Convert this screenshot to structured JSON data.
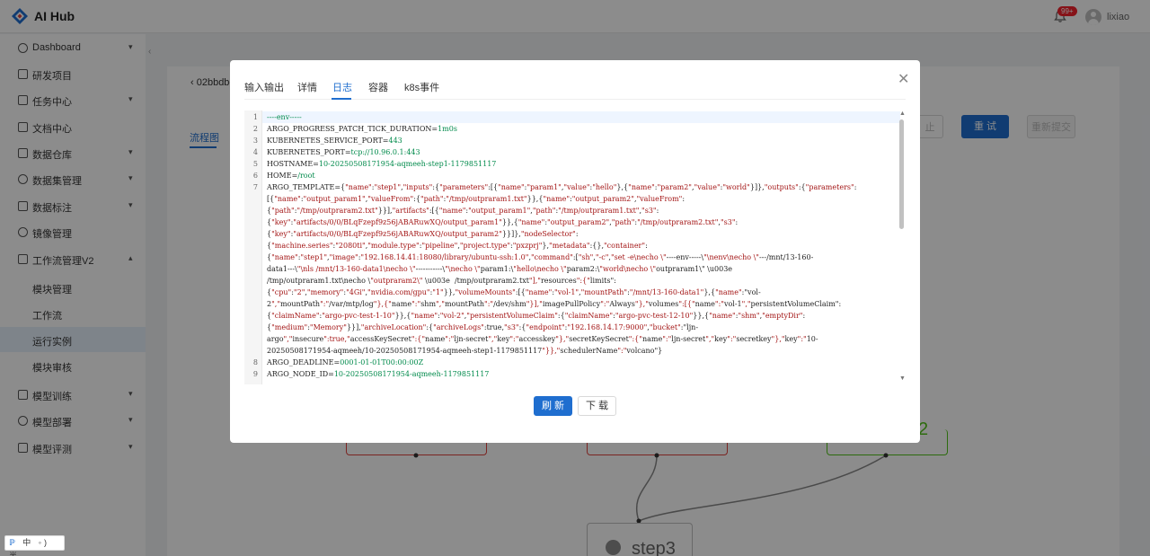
{
  "app": {
    "title": "AI Hub",
    "badge": "99+",
    "username": "lixiao"
  },
  "sidebar": {
    "items": [
      {
        "label": "Dashboard",
        "chevron": true
      },
      {
        "label": "研发项目",
        "chevron": false
      },
      {
        "label": "任务中心",
        "chevron": true
      },
      {
        "label": "文档中心",
        "chevron": false
      },
      {
        "label": "数据仓库",
        "chevron": true
      },
      {
        "label": "数据集管理",
        "chevron": true
      },
      {
        "label": "数据标注",
        "chevron": true
      },
      {
        "label": "镜像管理",
        "chevron": false
      },
      {
        "label": "工作流管理V2",
        "chevron": true
      }
    ],
    "subitems": [
      {
        "label": "模块管理"
      },
      {
        "label": "工作流"
      },
      {
        "label": "运行实例",
        "active": true
      },
      {
        "label": "模块审核"
      }
    ],
    "bottom_items": [
      {
        "label": "模型训练",
        "chevron": true
      },
      {
        "label": "模型部署",
        "chevron": true
      },
      {
        "label": "模型评测",
        "chevron": true
      }
    ]
  },
  "background": {
    "breadcrumb": "‹  02bbdbe",
    "tab": "流程图",
    "btn_faded": "止",
    "btn_retry": "重 试",
    "btn_resubmit": "重新提交",
    "node_green_text": "2",
    "node_step3": "step3"
  },
  "ime": {
    "text": "中 ◦) 半"
  },
  "modal": {
    "tabs": [
      "输入输出",
      "详情",
      "日志",
      "容器",
      "k8s事件"
    ],
    "active_tab": "日志",
    "close_icon": "close-icon",
    "refresh_label": "刷 新",
    "download_label": "下 载",
    "log_lines": [
      {
        "n": "1",
        "text": "----env-----"
      },
      {
        "n": "2",
        "text": "ARGO_PROGRESS_PATCH_TICK_DURATION=1m0s"
      },
      {
        "n": "3",
        "text": "KUBERNETES_SERVICE_PORT=443"
      },
      {
        "n": "4",
        "text": "KUBERNETES_PORT=tcp://10.96.0.1:443"
      },
      {
        "n": "5",
        "text": "HOSTNAME=10-20250508171954-aqmeeh-step1-1179851117"
      },
      {
        "n": "6",
        "text": "HOME=/root"
      },
      {
        "n": "7",
        "text": "ARGO_TEMPLATE={\"name\":\"step1\",\"inputs\":{\"parameters\":[{\"name\":\"param1\",\"value\":\"hello\"},{\"name\":\"param2\",\"value\":\"world\"}]},\"outputs\":{\"parameters\":"
      },
      {
        "n": "",
        "text": "[{\"name\":\"output_param1\",\"valueFrom\":{\"path\":\"/tmp/outpraram1.txt\"}},{\"name\":\"output_param2\",\"valueFrom\":"
      },
      {
        "n": "",
        "text": "{\"path\":\"/tmp/outpraram2.txt\"}}],\"artifacts\":[{\"name\":\"output_param1\",\"path\":\"/tmp/outpraram1.txt\",\"s3\":"
      },
      {
        "n": "",
        "text": "{\"key\":\"artifacts/0/0/BLqFzepf9z56jABARuwXQ/output_param1\"}},{\"name\":\"output_param2\",\"path\":\"/tmp/outpraram2.txt\",\"s3\":"
      },
      {
        "n": "",
        "text": "{\"key\":\"artifacts/0/0/BLqFzepf9z56jABARuwXQ/output_param2\"}}]},\"nodeSelector\":"
      },
      {
        "n": "",
        "text": "{\"machine.series\":\"2080ti\",\"module.type\":\"pipeline\",\"project.type\":\"pxzprj\"},\"metadata\":{},\"container\":"
      },
      {
        "n": "",
        "text": "{\"name\":\"step1\",\"image\":\"192.168.14.41:18080/library/ubuntu-ssh:1.0\",\"command\":[\"sh\",\"-c\",\"set -e\\necho \\\"----env-----\\\"\\nenv\\necho \\\"---/mnt/13-160-"
      },
      {
        "n": "",
        "text": "data1---\\\"\\nls /mnt/13-160-data1\\necho \\\"-----------\\\"\\necho \\\"param1:\\\"hello\\necho \\\"param2:\\\"world\\necho \\\"outpraram1\\\" \\u003e"
      },
      {
        "n": "",
        "text": "/tmp/outpraram1.txt\\necho \\\"outpraram2\\\" \\u003e  /tmp/outpraram2.txt\"],\"resources\":{\"limits\":"
      },
      {
        "n": "",
        "text": "{\"cpu\":\"2\",\"memory\":\"4Gi\",\"nvidia.com/gpu\":\"1\"}},\"volumeMounts\":[{\"name\":\"vol-1\",\"mountPath\":\"/mnt/13-160-data1\"},{\"name\":\"vol-"
      },
      {
        "n": "",
        "text": "2\",\"mountPath\":\"/var/mtp/log\"},{\"name\":\"shm\",\"mountPath\":\"/dev/shm\"}],\"imagePullPolicy\":\"Always\"},\"volumes\":[{\"name\":\"vol-1\",\"persistentVolumeClaim\":"
      },
      {
        "n": "",
        "text": "{\"claimName\":\"argo-pvc-test-1-10\"}},{\"name\":\"vol-2\",\"persistentVolumeClaim\":{\"claimName\":\"argo-pvc-test-12-10\"}},{\"name\":\"shm\",\"emptyDir\":"
      },
      {
        "n": "",
        "text": "{\"medium\":\"Memory\"}}],\"archiveLocation\":{\"archiveLogs\":true,\"s3\":{\"endpoint\":\"192.168.14.17:9000\",\"bucket\":\"ljn-"
      },
      {
        "n": "",
        "text": "argo\",\"insecure\":true,\"accessKeySecret\":{\"name\":\"ljn-secret\",\"key\":\"accesskey\"},\"secretKeySecret\":{\"name\":\"ljn-secret\",\"key\":\"secretkey\"},\"key\":\"10-"
      },
      {
        "n": "",
        "text": "20250508171954-aqmeeh/10-20250508171954-aqmeeh-step1-1179851117\"}},\"schedulerName\":\"volcano\"}"
      },
      {
        "n": "8",
        "text": "ARGO_DEADLINE=0001-01-01T00:00:00Z"
      },
      {
        "n": "9",
        "text": "ARGO_NODE_ID=10-20250508171954-aqmeeh-1179851117"
      }
    ]
  }
}
